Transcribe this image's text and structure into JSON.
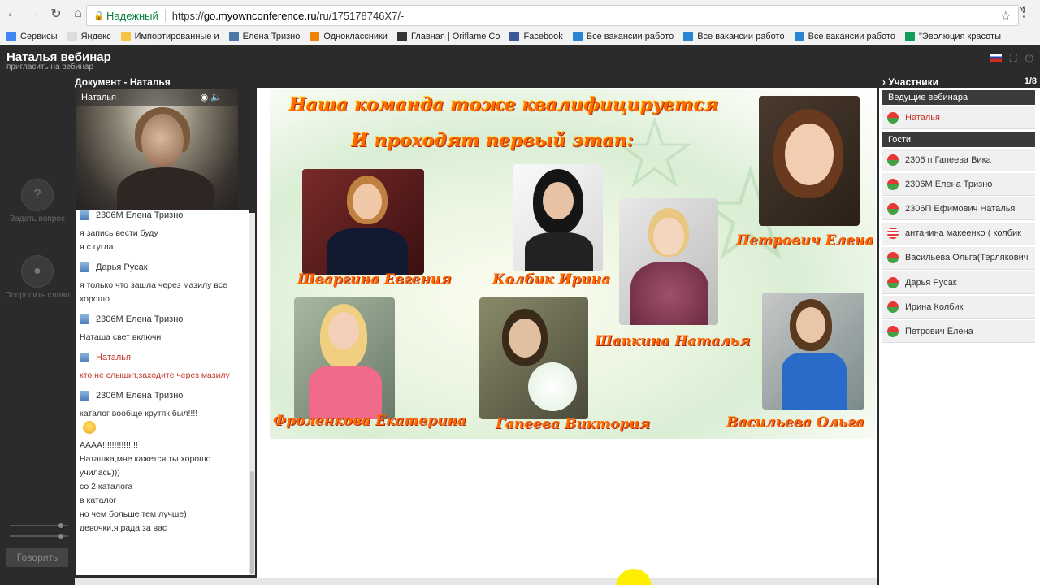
{
  "browser": {
    "secure_label": "Надежный",
    "url_scheme": "https://",
    "url_host": "go.myownconference.ru",
    "url_path": "/ru/175178746X7/-",
    "bookmarks": [
      {
        "label": "Сервисы",
        "icon": "apps-grid-icon",
        "color": "#4285f4"
      },
      {
        "label": "Яндекс",
        "icon": "page-icon",
        "color": "#dddddd"
      },
      {
        "label": "Импортированные и",
        "icon": "folder-icon",
        "color": "#f6c344"
      },
      {
        "label": "Елена Тризно",
        "icon": "vk-icon",
        "color": "#4a76a8"
      },
      {
        "label": "Одноклассники",
        "icon": "mail-icon",
        "color": "#ee8208"
      },
      {
        "label": "Главная | Oriflame Co",
        "icon": "oriflame-icon",
        "color": "#333333"
      },
      {
        "label": "Facebook",
        "icon": "facebook-icon",
        "color": "#3b5998"
      },
      {
        "label": "Все вакансии работо",
        "icon": "folder-blue-icon",
        "color": "#2a84d4"
      },
      {
        "label": "Все вакансии работо",
        "icon": "folder-blue-icon",
        "color": "#2a84d4"
      },
      {
        "label": "Все вакансии работо",
        "icon": "folder-blue-icon",
        "color": "#2a84d4"
      },
      {
        "label": "\"Эволюция красоты",
        "icon": "sheets-icon",
        "color": "#0f9d58"
      }
    ],
    "more": "»"
  },
  "app": {
    "title": "Наталья вебинар",
    "subtitle": "пригласить на вебинар"
  },
  "rail": {
    "ask_label": "Задать вопрос",
    "request_label": "Попросить слово",
    "speak_label": "Говорить"
  },
  "document": {
    "title": "Документ - Наталья"
  },
  "video": {
    "name": "Наталья"
  },
  "chat": {
    "messages": [
      {
        "author": "2306М Елена Тризно",
        "lines": [
          "я запись вести буду",
          "я с гугла"
        ]
      },
      {
        "author": "Дарья Русак",
        "lines": [
          "я только что зашла через мазилу все хорошо"
        ]
      },
      {
        "author": "2306М Елена Тризно",
        "lines": [
          "Наташа свет включи"
        ]
      },
      {
        "author": "Наталья",
        "lines": [
          "кто не слышит,заходите через мазилу"
        ]
      },
      {
        "author": "2306М Елена Тризно",
        "lines": [
          "каталог вообще крутяк был!!!!",
          "АААА!!!!!!!!!!!!!!!",
          "Наташка,мне кажется ты хорошо училась)))",
          "со 2 каталога",
          "в каталог",
          "но чем больше тем лучше)",
          "девочки,я рада за вас"
        ]
      }
    ]
  },
  "slide": {
    "title1": "Наша команда тоже квалифицируется",
    "title2": "И проходят первый этап:",
    "names": [
      "Шваргина Евгения",
      "Колбик Ирина",
      "Петрович Елена",
      "Шапкина Наталья",
      "Фроленкова Екатерина",
      "Гапеева Виктория",
      "Васильева Ольга"
    ]
  },
  "participants": {
    "title": "Участники",
    "count": "1/8",
    "hosts_label": "Ведущие вебинара",
    "guests_label": "Гости",
    "hosts": [
      "Наталья"
    ],
    "guests": [
      "2306 п Гапеева Вика",
      "2306М Елена Тризно",
      "2306П Ефимович Наталья",
      "антанина макеенко ( колбик",
      "Васильева Ольга(Терлякович",
      "Дарья Русак",
      "Ирина Колбик",
      "Петрович Елена"
    ]
  }
}
